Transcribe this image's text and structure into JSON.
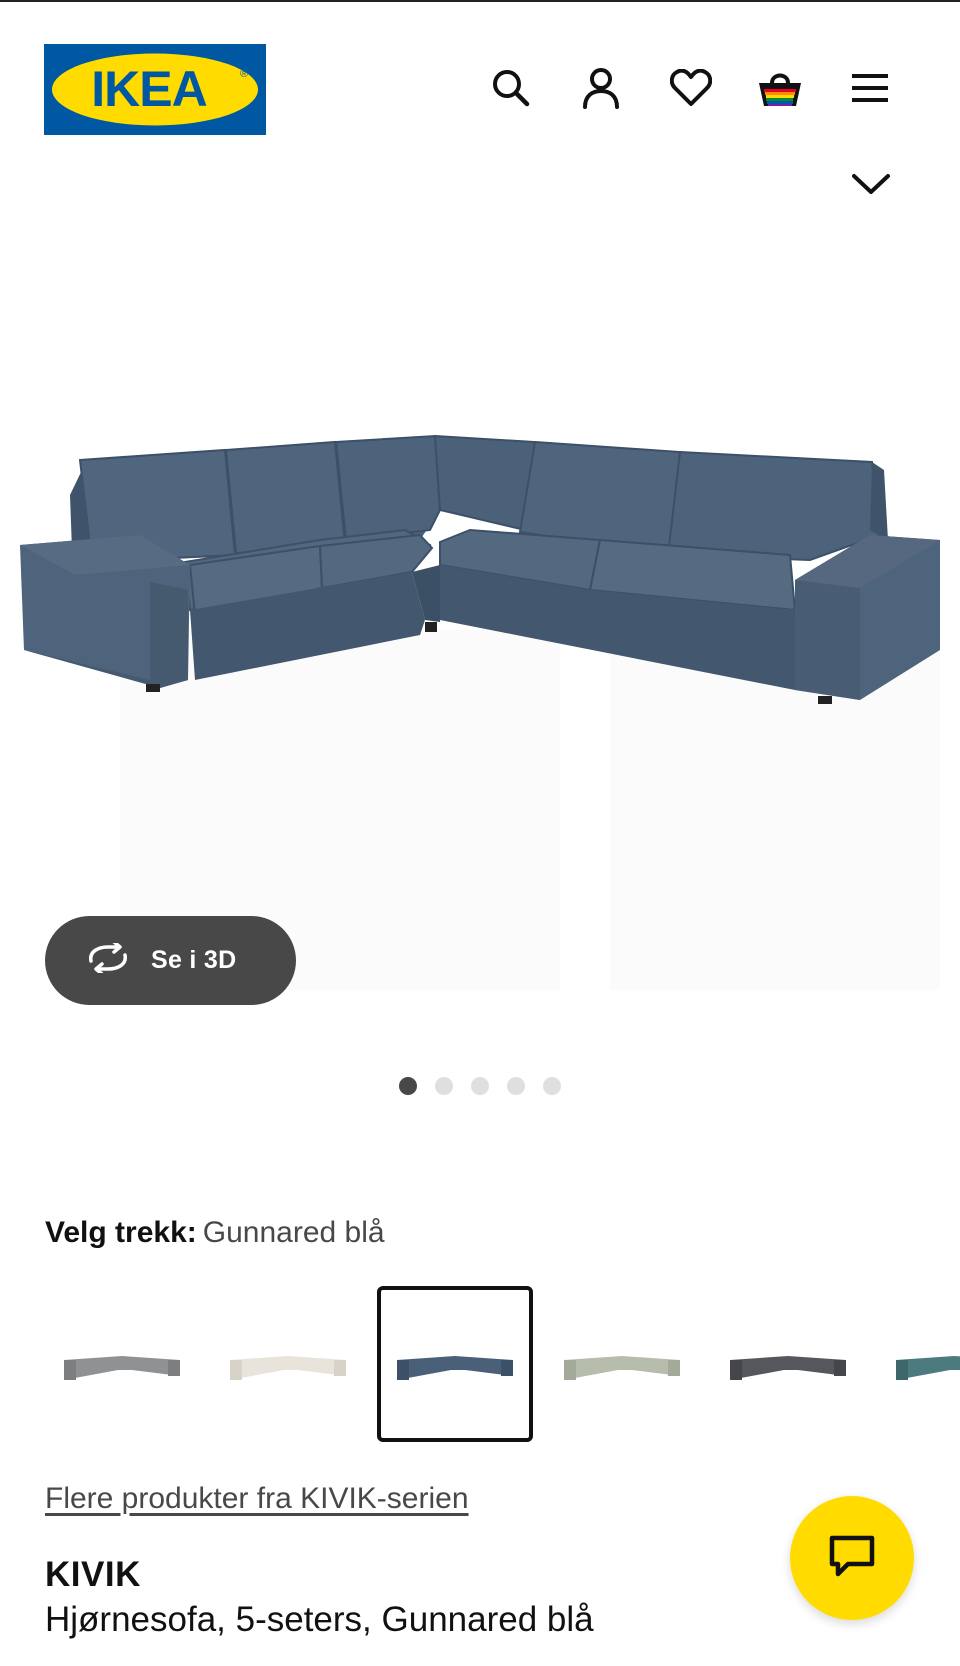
{
  "header": {
    "logo_text": "IKEA",
    "logo_registered": "®",
    "icons": [
      "search-icon",
      "account-icon",
      "heart-icon",
      "basket-icon",
      "menu-icon"
    ],
    "brand_blue": "#0058a3",
    "brand_yellow": "#ffdb00"
  },
  "gallery": {
    "view_3d_label": "Se i 3D",
    "dots_total": 5,
    "dots_active": 1
  },
  "cover": {
    "label": "Velg trekk:",
    "selected": "Gunnared blå",
    "swatch_colors": [
      "#8f9193",
      "#e8e4dc",
      "#4a6078",
      "#b6bdad",
      "#56575c",
      "#4c7b7f"
    ],
    "selected_index": 2
  },
  "series_link": "Flere produkter fra KIVIK-serien",
  "product": {
    "name": "KIVIK",
    "description": "Hjørnesofa, 5-seters, Gunnared blå"
  }
}
